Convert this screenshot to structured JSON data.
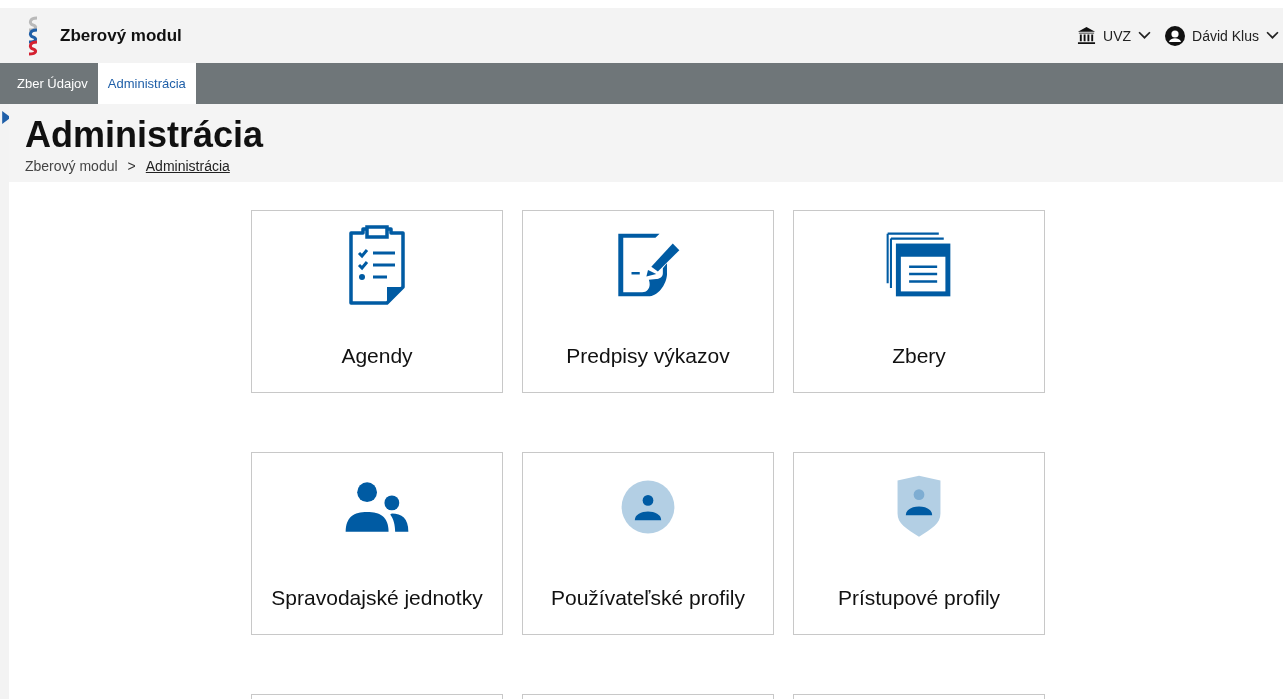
{
  "header": {
    "app_title": "Zberový modul",
    "organization": "UVZ",
    "user": "Dávid Klus"
  },
  "tabs": [
    {
      "label": "Zber Údajov",
      "selected": false
    },
    {
      "label": "Administrácia",
      "selected": true
    }
  ],
  "page": {
    "title": "Administrácia",
    "breadcrumb_separator": ">",
    "breadcrumb": [
      {
        "label": "Zberový modul",
        "current": false
      },
      {
        "label": "Administrácia",
        "current": true
      }
    ]
  },
  "tiles": [
    {
      "kind": "clipboard",
      "label": "Agendy"
    },
    {
      "kind": "document-edit",
      "label": "Predpisy výkazov"
    },
    {
      "kind": "stack",
      "label": "Zbery"
    },
    {
      "kind": "group",
      "label": "Spravodajské jednotky"
    },
    {
      "kind": "user-circle",
      "label": "Používateľské profily"
    },
    {
      "kind": "user-shield",
      "label": "Prístupové profily"
    },
    {
      "kind": "hidden"
    },
    {
      "kind": "hidden"
    },
    {
      "kind": "hidden"
    }
  ]
}
